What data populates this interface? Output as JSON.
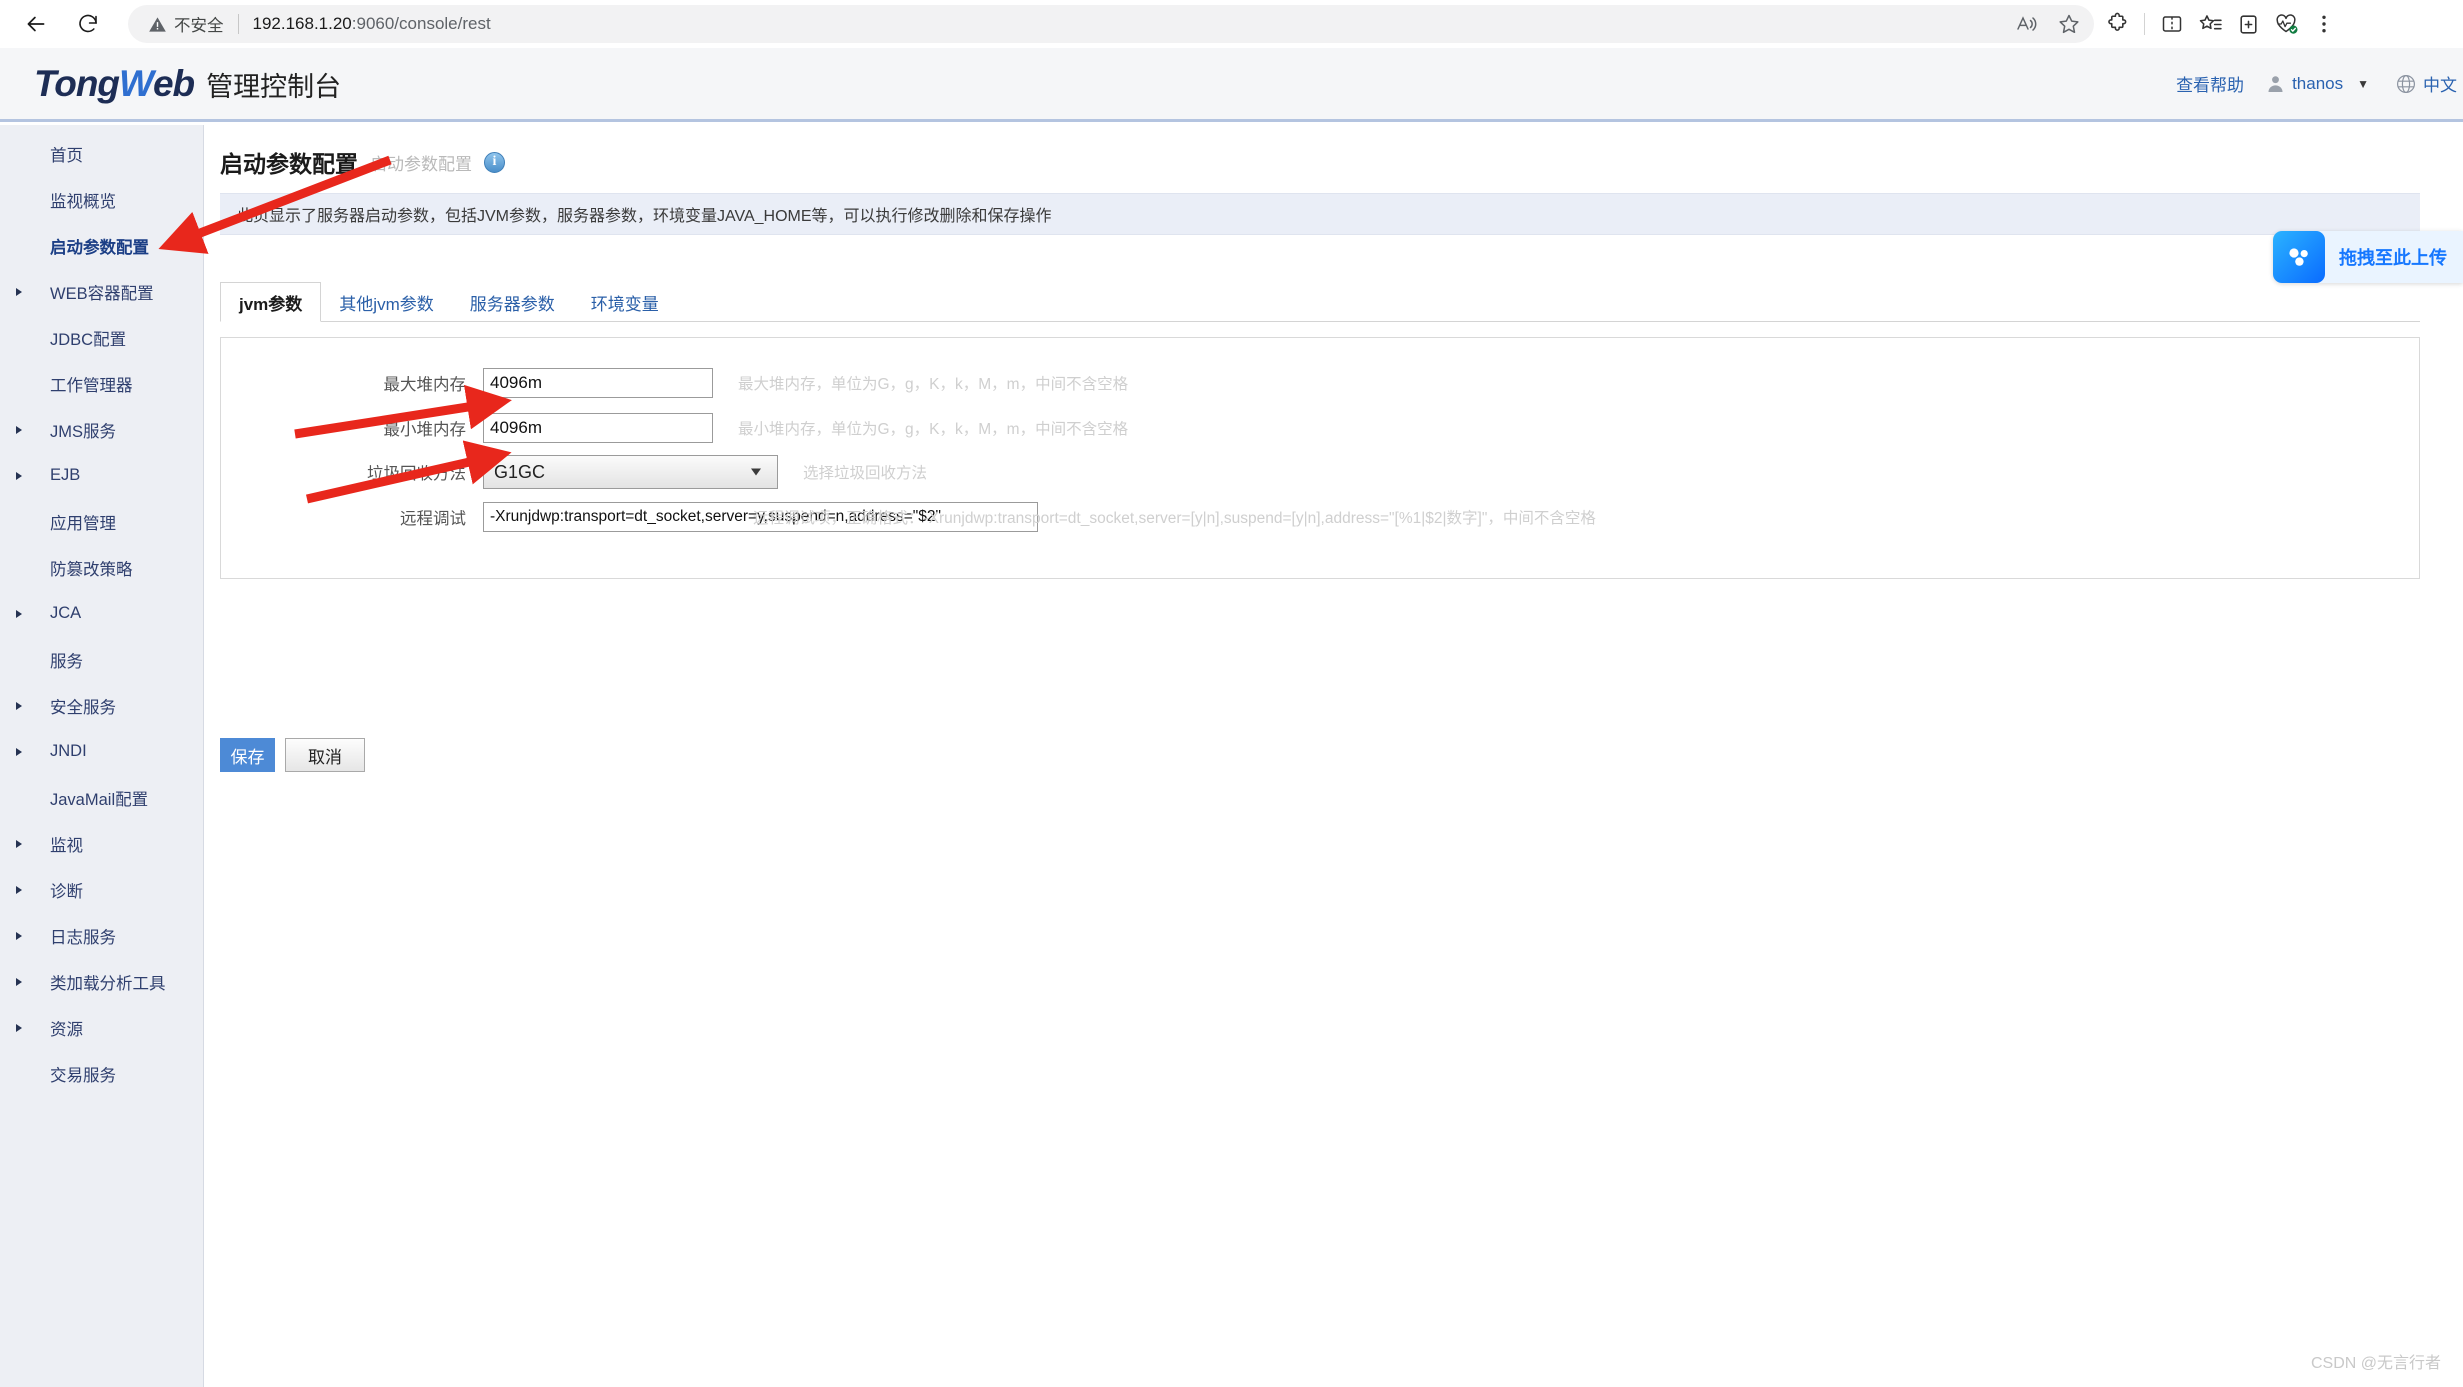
{
  "browser": {
    "back_icon": "back-arrow-icon",
    "reload_icon": "reload-icon",
    "security_label": "不安全",
    "security_icon": "warning-triangle-icon",
    "url_host": "192.168.1.20",
    "url_path": ":9060/console/rest",
    "url_full": "192.168.1.20:9060/console/rest",
    "toolbar_icons": [
      "read-aloud-icon",
      "favorite-star-icon",
      "extensions-puzzle-icon",
      "split-screen-icon",
      "collections-star-list-icon",
      "add-tab-to-collection-icon",
      "browser-essentials-heart-icon",
      "settings-more-icon"
    ]
  },
  "header": {
    "brand_tong": "Tong",
    "brand_w": "W",
    "brand_eb": "eb",
    "brand_console": "管理控制台",
    "help_label": "查看帮助",
    "user_name": "thanos",
    "user_caret": "▼",
    "lang_label": "中文",
    "accent_color": "#2a62b0",
    "header_bg": "#f5f6f8",
    "header_border": "#b4c4e0"
  },
  "sidebar": {
    "items": [
      {
        "label": "首页",
        "expandable": false,
        "active": false
      },
      {
        "label": "监视概览",
        "expandable": false,
        "active": false
      },
      {
        "label": "启动参数配置",
        "expandable": false,
        "active": true
      },
      {
        "label": "WEB容器配置",
        "expandable": true,
        "active": false
      },
      {
        "label": "JDBC配置",
        "expandable": false,
        "active": false
      },
      {
        "label": "工作管理器",
        "expandable": false,
        "active": false
      },
      {
        "label": "JMS服务",
        "expandable": true,
        "active": false
      },
      {
        "label": "EJB",
        "expandable": true,
        "active": false
      },
      {
        "label": "应用管理",
        "expandable": false,
        "active": false
      },
      {
        "label": "防篡改策略",
        "expandable": false,
        "active": false
      },
      {
        "label": "JCA",
        "expandable": true,
        "active": false
      },
      {
        "label": "服务",
        "expandable": false,
        "active": false
      },
      {
        "label": "安全服务",
        "expandable": true,
        "active": false
      },
      {
        "label": "JNDI",
        "expandable": true,
        "active": false
      },
      {
        "label": "JavaMail配置",
        "expandable": false,
        "active": false
      },
      {
        "label": "监视",
        "expandable": true,
        "active": false
      },
      {
        "label": "诊断",
        "expandable": true,
        "active": false
      },
      {
        "label": "日志服务",
        "expandable": true,
        "active": false
      },
      {
        "label": "类加载分析工具",
        "expandable": true,
        "active": false
      },
      {
        "label": "资源",
        "expandable": true,
        "active": false
      },
      {
        "label": "交易服务",
        "expandable": false,
        "active": false
      }
    ]
  },
  "main": {
    "title": "启动参数配置",
    "subtitle": "启动参数配置",
    "info_icon": "info-circle-icon",
    "info_glyph": "i",
    "description": "此页显示了服务器启动参数，包括JVM参数，服务器参数，环境变量JAVA_HOME等，可以执行修改删除和保存操作",
    "tabs": [
      {
        "label": "jvm参数",
        "active": true
      },
      {
        "label": "其他jvm参数",
        "active": false
      },
      {
        "label": "服务器参数",
        "active": false
      },
      {
        "label": "环境变量",
        "active": false
      }
    ],
    "form": {
      "max_heap": {
        "label": "最大堆内存",
        "value": "4096m",
        "hint": "最大堆内存，单位为G，g，K，k，M，m，中间不含空格"
      },
      "min_heap": {
        "label": "最小堆内存",
        "value": "4096m",
        "hint": "最小堆内存，单位为G，g，K，k，M，m，中间不含空格"
      },
      "gc_method": {
        "label": "垃圾回收方法",
        "value": "G1GC",
        "hint": "选择垃圾回收方法",
        "caret_icon": "chevron-down-icon"
      },
      "remote_debug": {
        "label": "远程调试",
        "value": "-Xrunjdwp:transport=dt_socket,server=y,suspend=n,address=\"$2\"",
        "hint": "远程调试项，正确格式：-Xrunjdwp:transport=dt_socket,server=[y|n],suspend=[y|n],address=\"[%1|$2|数字]\"，中间不含空格"
      }
    },
    "buttons": {
      "save_label": "保存",
      "cancel_label": "取消",
      "save_color": "#4d8ad6"
    }
  },
  "upload_widget": {
    "label": "拖拽至此上传",
    "icon": "baidu-netdisk-icon",
    "accent_color": "#1677ff"
  },
  "watermark": "CSDN @无言行者"
}
